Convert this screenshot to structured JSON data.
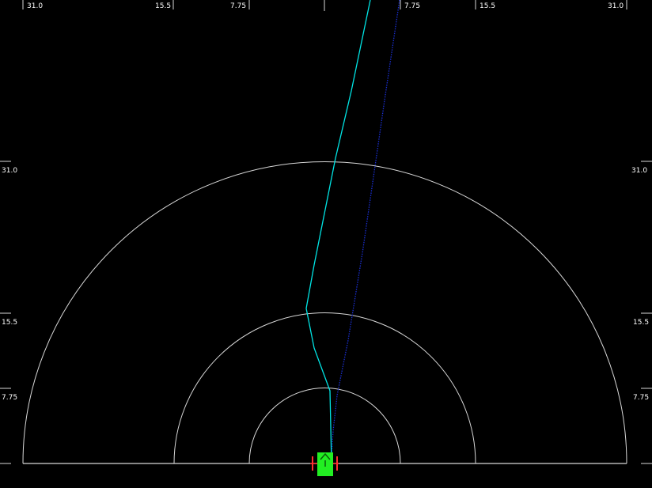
{
  "top_labels": {
    "left_outer": "31.0",
    "left_mid": "15.5",
    "left_inner": "7.75",
    "right_inner": "7.75",
    "right_mid": "15.5",
    "right_outer": "31.0"
  },
  "side_labels": {
    "left": [
      "31.0",
      "15.5",
      "7.75"
    ],
    "right": [
      "31.0",
      "15.5",
      "7.75"
    ]
  },
  "colors": {
    "background": "#000000",
    "rings": "#d8d8d8",
    "planned_path": "#00e5e5",
    "reference_path": "#1a2fd0",
    "vehicle": "#22ee22",
    "vehicle_markers": "#ff3030"
  },
  "icons": {
    "vehicle": "robot-vehicle-icon",
    "heading": "caret-up-icon"
  }
}
